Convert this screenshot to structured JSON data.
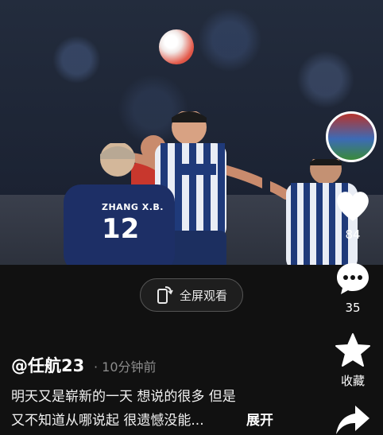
{
  "video": {
    "jersey_name": "ZHANG X.B.",
    "jersey_number": "12",
    "ball_colors": [
      "#ffffff",
      "#e35a4a"
    ],
    "team_colors": [
      "#1f3a7a",
      "#ffffff",
      "#c8372d"
    ]
  },
  "fullscreen": {
    "label": "全屏观看",
    "icon": "rotate-phone-icon"
  },
  "actions": {
    "like": {
      "icon": "heart-icon",
      "count": "84"
    },
    "comment": {
      "icon": "comment-bubble-icon",
      "count": "35"
    },
    "favorite": {
      "icon": "star-icon",
      "label": "收藏"
    },
    "share": {
      "icon": "share-arrow-icon"
    }
  },
  "post": {
    "author": "@任航23",
    "time": "· 10分钟前",
    "caption_line1": "明天又是崭新的一天 想说的很多 但是",
    "caption_line2": "又不知道从哪说起 很遗憾没能...",
    "expand_label": "展开"
  },
  "colors": {
    "background": "#111111",
    "muted_text": "#8c8c8c",
    "accent_white": "#ffffff"
  }
}
